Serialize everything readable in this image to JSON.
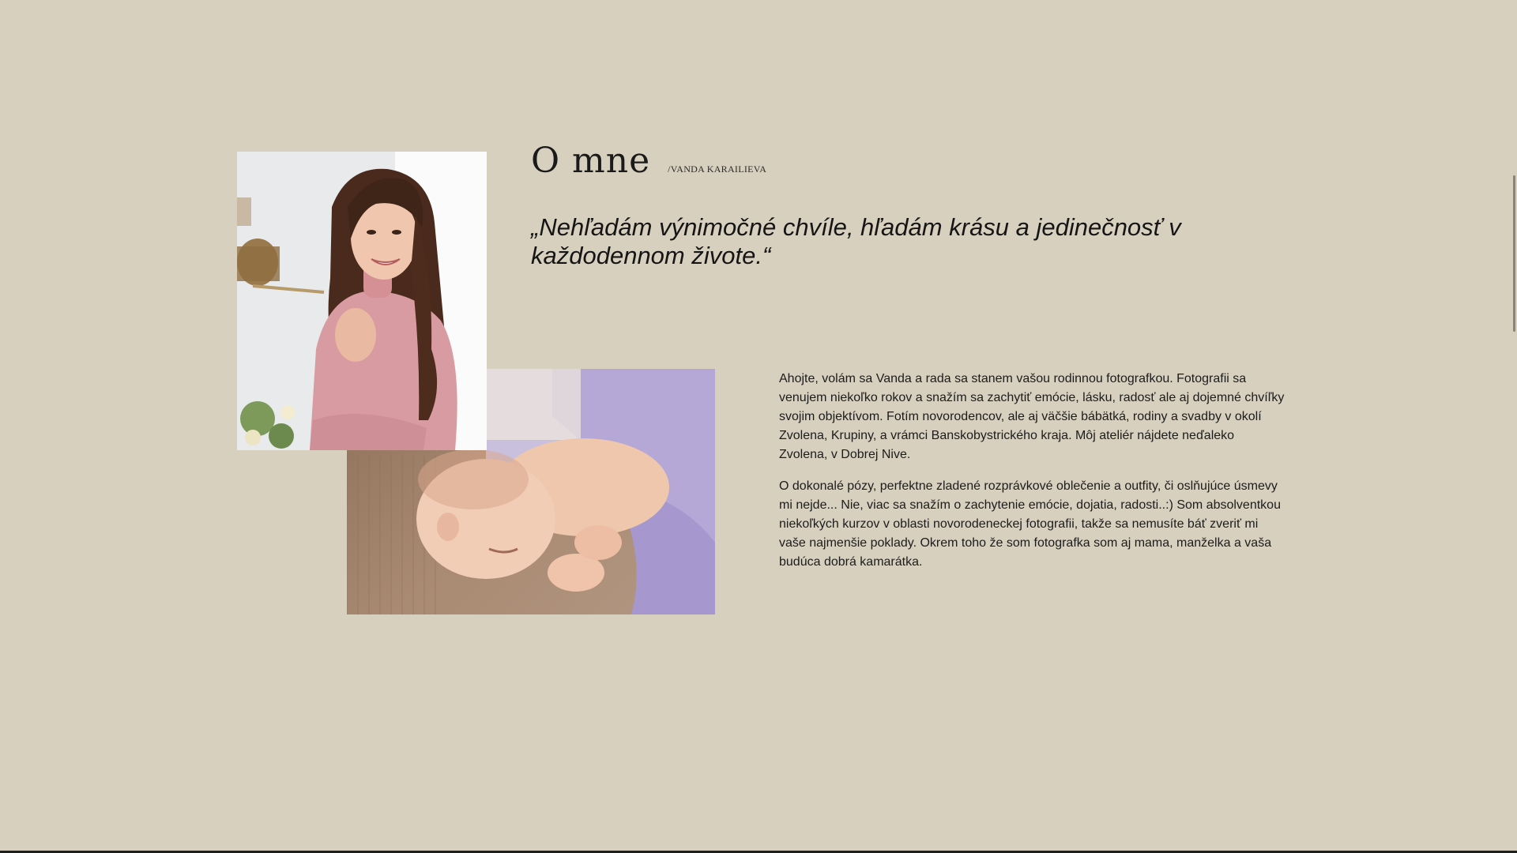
{
  "about": {
    "title": "O mne",
    "subtitle": "/VANDA KARAILIEVA",
    "quote": "„Nehľadám výnimočné chvíle, hľadám krásu a jedinečnosť v každodennom živote.“",
    "paragraphs": [
      "Ahojte, volám sa Vanda a rada sa stanem vašou rodinnou fotografkou. Fotografii sa venujem niekoľko rokov a snažím sa zachytiť emócie, lásku, radosť ale aj dojemné chvíľky svojim objektívom. Fotím novorodencov, ale aj väčšie bábätká, rodiny a svadby v okolí Zvolena, Krupiny, a vrámci Banskobystrického kraja. Môj ateliér nájdete neďaleko Zvolena, v Dobrej Nive.",
      "O dokonalé pózy, perfektne zladené rozprávkové oblečenie a outfity, či oslňujúce úsmevy mi nejde... Nie, viac sa snažím o zachytenie emócie, dojatia, radosti..:) Som absolventkou niekoľkých kurzov v oblasti novorodeneckej fotografii, takže sa nemusíte báť zveriť mi vaše najmenšie poklady. Okrem toho že som fotografka som aj mama, manželka a vaša budúca dobrá kamarátka."
    ]
  },
  "colors": {
    "background": "#d8d0bf",
    "text": "#1b1b1b"
  }
}
